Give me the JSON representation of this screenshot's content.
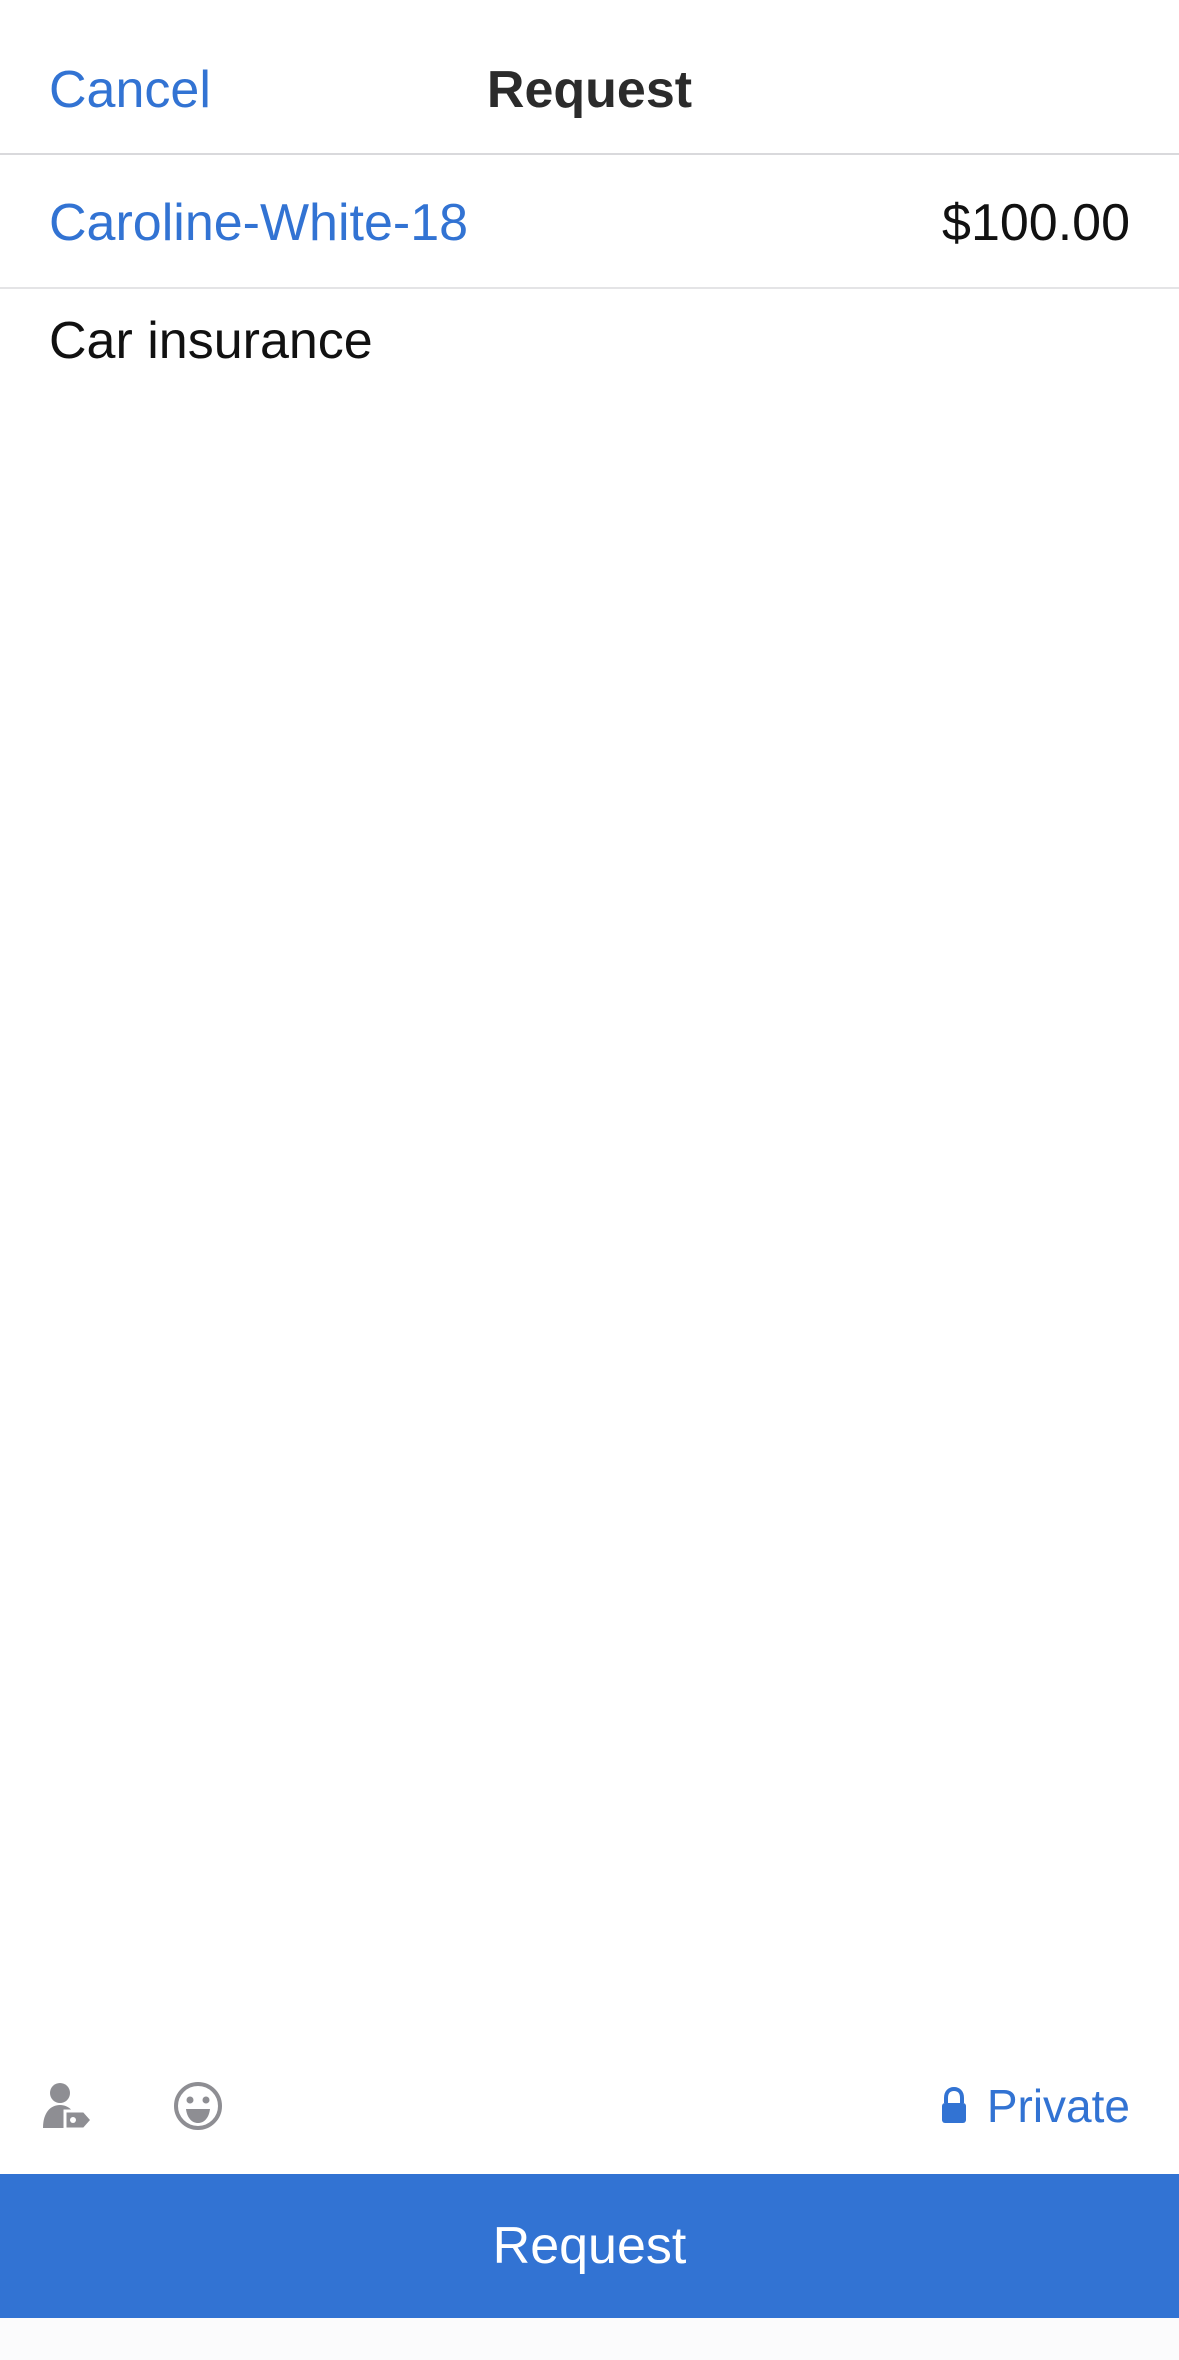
{
  "header": {
    "cancel_label": "Cancel",
    "title": "Request"
  },
  "recipient": {
    "name": "Caroline-White-18",
    "amount": "$100.00"
  },
  "note": {
    "text": "Car insurance"
  },
  "toolbar": {
    "tag_icon": "tag-person-icon",
    "emoji_icon": "emoji-icon",
    "privacy_icon": "lock-icon",
    "privacy_label": "Private"
  },
  "action": {
    "submit_label": "Request"
  },
  "colors": {
    "accent": "#3273d3",
    "text": "#111111",
    "muted_icon": "#8e8e93",
    "divider": "#d9d9dc"
  }
}
